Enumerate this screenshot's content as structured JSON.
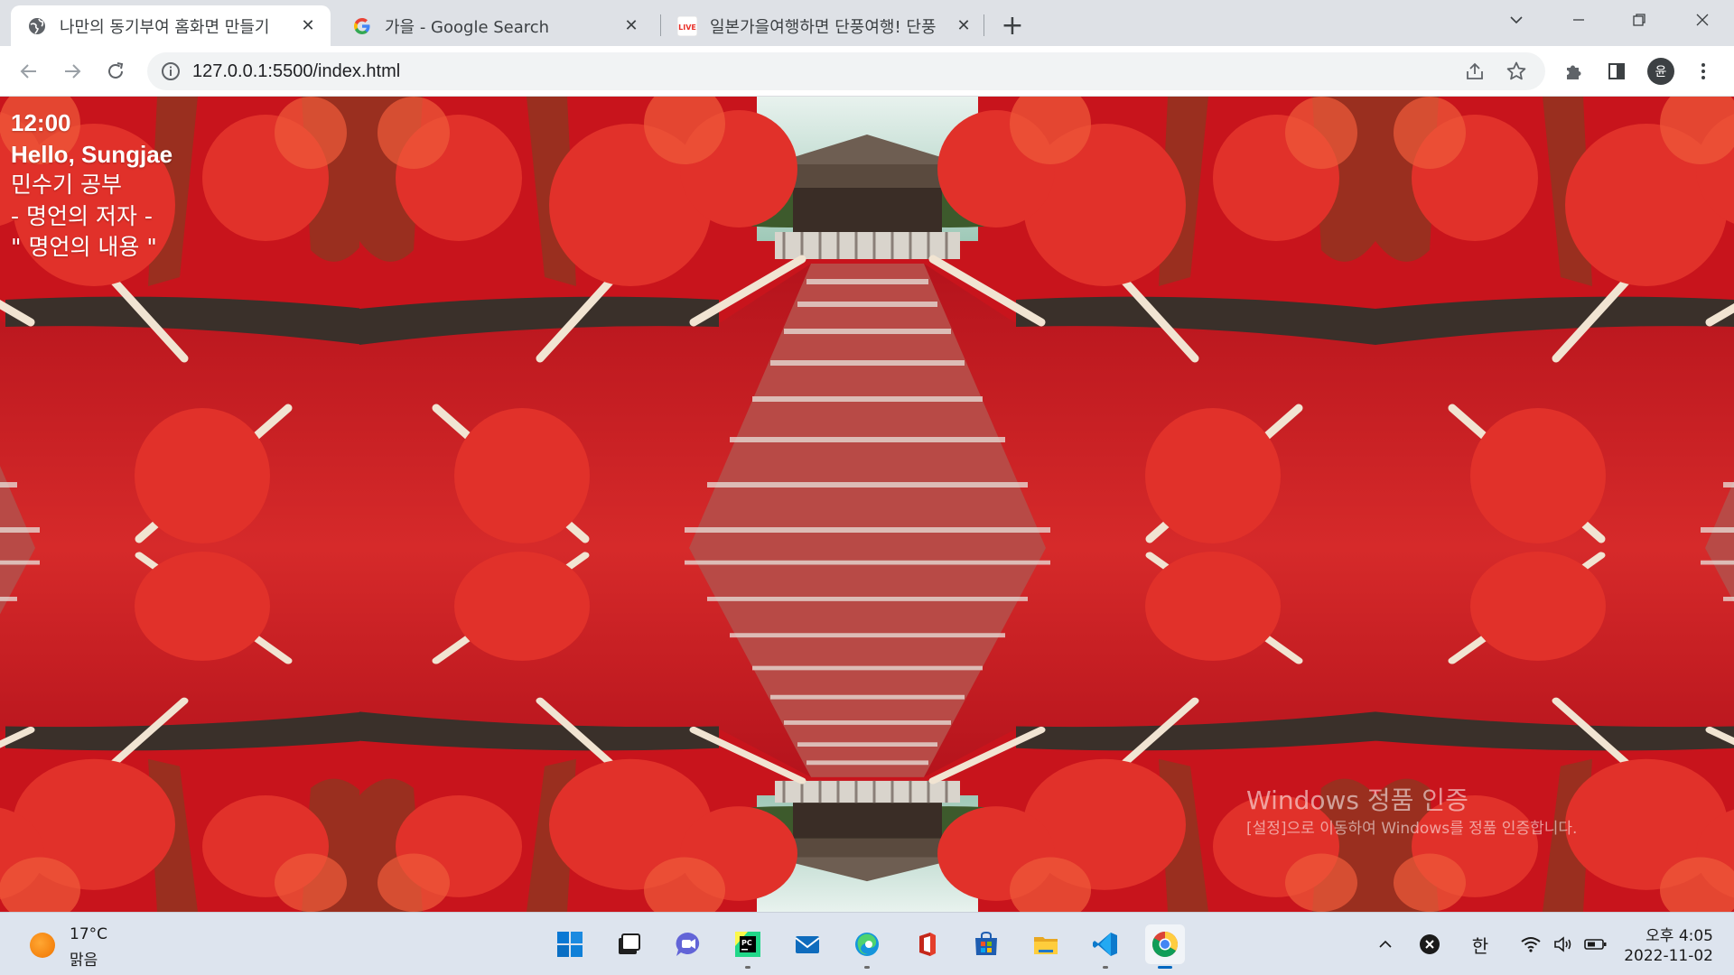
{
  "browser": {
    "tabs": [
      {
        "title": "나만의 동기부여 홈화면 만들기",
        "active": true,
        "favicon": "globe-icon"
      },
      {
        "title": "가을 - Google Search",
        "active": false,
        "favicon": "google-icon"
      },
      {
        "title": "일본가을여행하면 단풍여행! 단풍",
        "active": false,
        "favicon": "live-icon",
        "favicon_text": "LIVE"
      }
    ],
    "url": "127.0.0.1:5500/index.html",
    "profile_initial": "윤"
  },
  "page": {
    "clock": "12:00",
    "greeting": "Hello, Sungjae",
    "todo": "민수기 공부",
    "quote_author": "- 명언의 저자 -",
    "quote_text": "\" 명언의 내용 \""
  },
  "watermark": {
    "title": "Windows 정품 인증",
    "body": "[설정]으로 이동하여 Windows를 정품 인증합니다."
  },
  "taskbar": {
    "weather_temp": "17°C",
    "weather_condition": "맑음",
    "apps": [
      "start-icon",
      "task-view-icon",
      "chat-icon",
      "pycharm-icon",
      "mail-icon",
      "edge-icon",
      "office-icon",
      "store-icon",
      "file-explorer-icon",
      "vscode-icon",
      "chrome-icon"
    ],
    "ime": "한",
    "time": "오후 4:05",
    "date": "2022-11-02"
  },
  "colors": {
    "tab_strip": "#dee1e6",
    "foliage_red": "#d41a1f",
    "taskbar": "#dde4ee",
    "accent": "#0067c0"
  }
}
